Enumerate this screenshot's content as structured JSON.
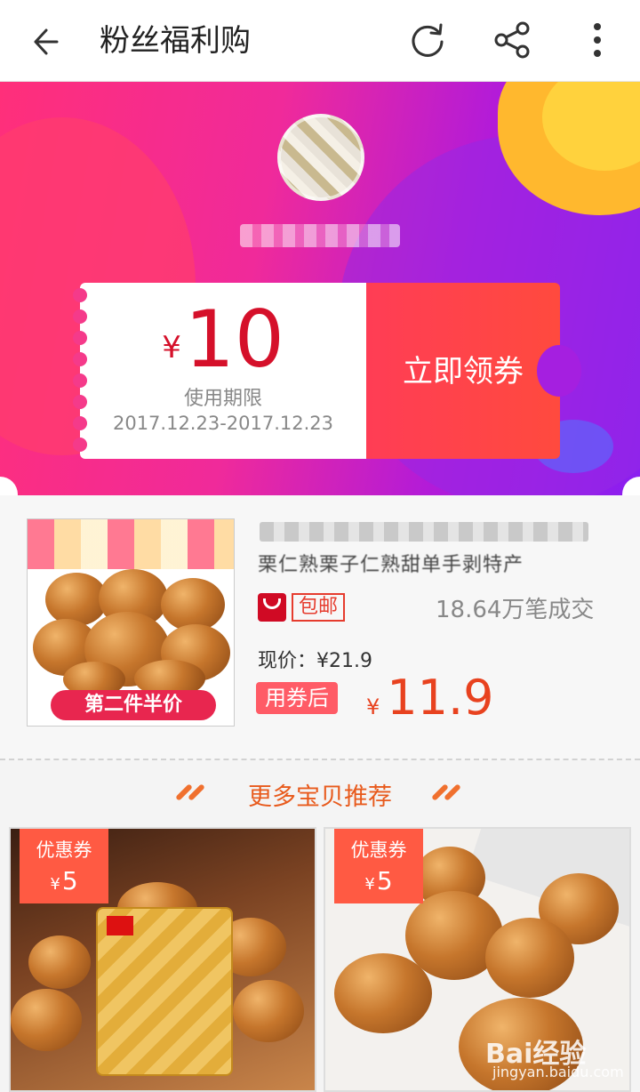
{
  "topbar": {
    "title": "粉丝福利购"
  },
  "coupon": {
    "currency": "¥",
    "amount": "10",
    "validity_label": "使用期限",
    "validity_dates": "2017.12.23-2017.12.23",
    "claim_label": "立即领券"
  },
  "product": {
    "title_line2": "栗仁熟栗子仁熟甜单手剥特产",
    "image_badge": "第二件半价",
    "free_shipping": "包邮",
    "sales": "18.64万笔成交",
    "current_price_label": "现价：¥21.9",
    "after_coupon_label": "用券后",
    "after_coupon_currency": "¥",
    "after_coupon_price": "11.9"
  },
  "recommend": {
    "title": "更多宝贝推荐"
  },
  "cards": [
    {
      "tag_label": "优惠券",
      "tag_currency": "¥",
      "tag_amount": "5"
    },
    {
      "tag_label": "优惠券",
      "tag_currency": "¥",
      "tag_amount": "5"
    }
  ],
  "watermark": {
    "logo_text": "Bai经验",
    "url": "jingyan.baidu.com"
  },
  "colors": {
    "accent": "#e8421f",
    "coupon_red": "#d5102a",
    "claim_bg": "#ff3d55"
  }
}
